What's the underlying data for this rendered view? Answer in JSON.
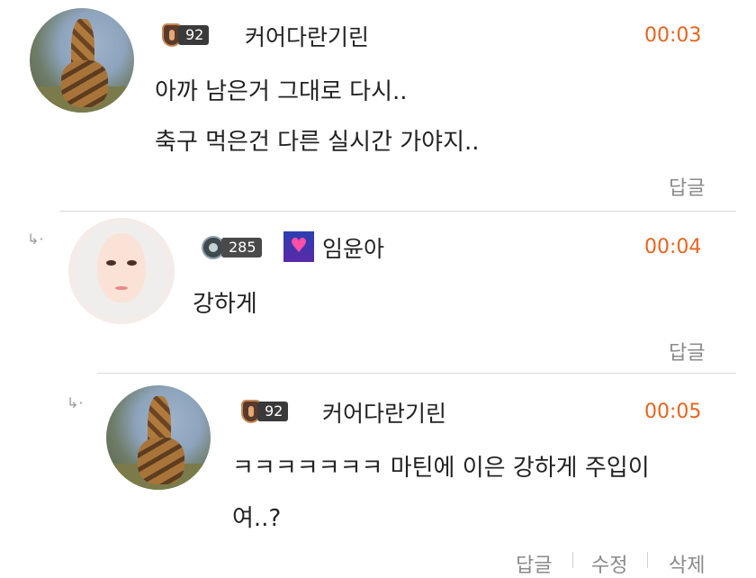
{
  "comments": [
    {
      "avatar_icon": "giraffe-avatar",
      "level": "92",
      "username": "커어다란기린",
      "time": "00:03",
      "lines": [
        "아까 남은거 그대로 다시..",
        "축구 먹은건 다른 실시간 가야지.."
      ],
      "actions": [
        "답글"
      ]
    },
    {
      "reply_icon": "reply-arrow-icon",
      "avatar_icon": "girl-avatar",
      "level": "285",
      "emblem_icon": "heart-emblem-icon",
      "username": "임윤아",
      "time": "00:04",
      "lines": [
        "강하게"
      ],
      "actions": [
        "답글"
      ]
    },
    {
      "reply_icon": "reply-arrow-icon",
      "avatar_icon": "giraffe-avatar",
      "level": "92",
      "username": "커어다란기린",
      "time": "00:05",
      "lines": [
        "ㅋㅋㅋㅋㅋㅋㅋ 마틴에 이은 강하게 주입이",
        "여..?"
      ],
      "actions": [
        "답글",
        "수정",
        "삭제"
      ]
    }
  ],
  "colors": {
    "time": "#e8641e",
    "action": "#8a8a8a",
    "divider": "#d8d8d8"
  }
}
